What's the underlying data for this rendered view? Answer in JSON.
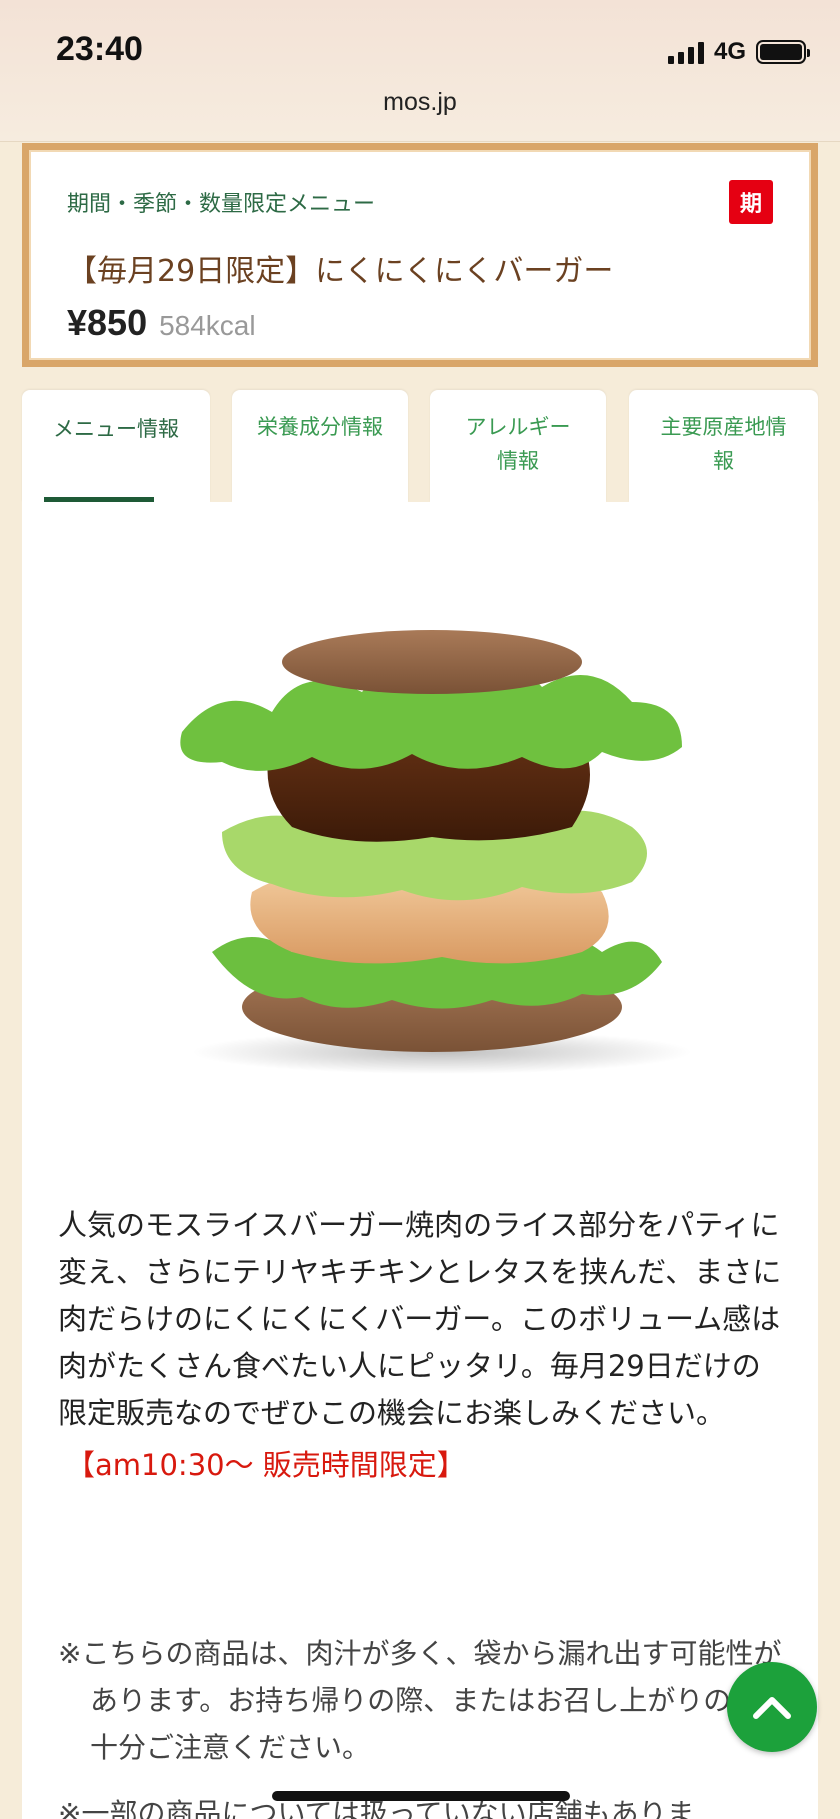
{
  "status_bar": {
    "time": "23:40",
    "network": "4G",
    "url": "mos.jp",
    "icons": [
      "signal-icon",
      "battery-icon"
    ]
  },
  "product": {
    "category": "期間・季節・数量限定メニュー",
    "badge": "期",
    "title": "【毎月29日限定】にくにくにくバーガー",
    "price": "¥850",
    "kcal": "584kcal"
  },
  "tabs": [
    {
      "label": "メニュー情報",
      "active": true
    },
    {
      "label": "栄養成分情報",
      "active": false
    },
    {
      "label": "アレルギー情報",
      "active": false
    },
    {
      "label": "主要原産地情報",
      "active": false
    }
  ],
  "content": {
    "description": "人気のモスライスバーガー焼肉のライス部分をパティに変え、さらにテリヤキチキンとレタスを挟んだ、まさに肉だらけのにくにくにくバーガー。このボリューム感は肉がたくさん食べたい人にピッタリ。毎月29日だけの限定販売なのでぜひこの機会にお楽しみください。",
    "notice": "【am10:30〜 販売時間限定】",
    "note1": "※こちらの商品は、肉汁が多く、袋から漏れ出す可能性があります。お持ち帰りの際、またはお召し上がりの際は十分ご注意ください。",
    "note2": "※一部の商品については扱っていない店舗もありま"
  },
  "colors": {
    "brand_green": "#1ca13b",
    "badge_red": "#e50012",
    "frame": "#d9a669",
    "notice_red": "#d8190e"
  },
  "scroll_top_icon": "chevron-up-icon"
}
